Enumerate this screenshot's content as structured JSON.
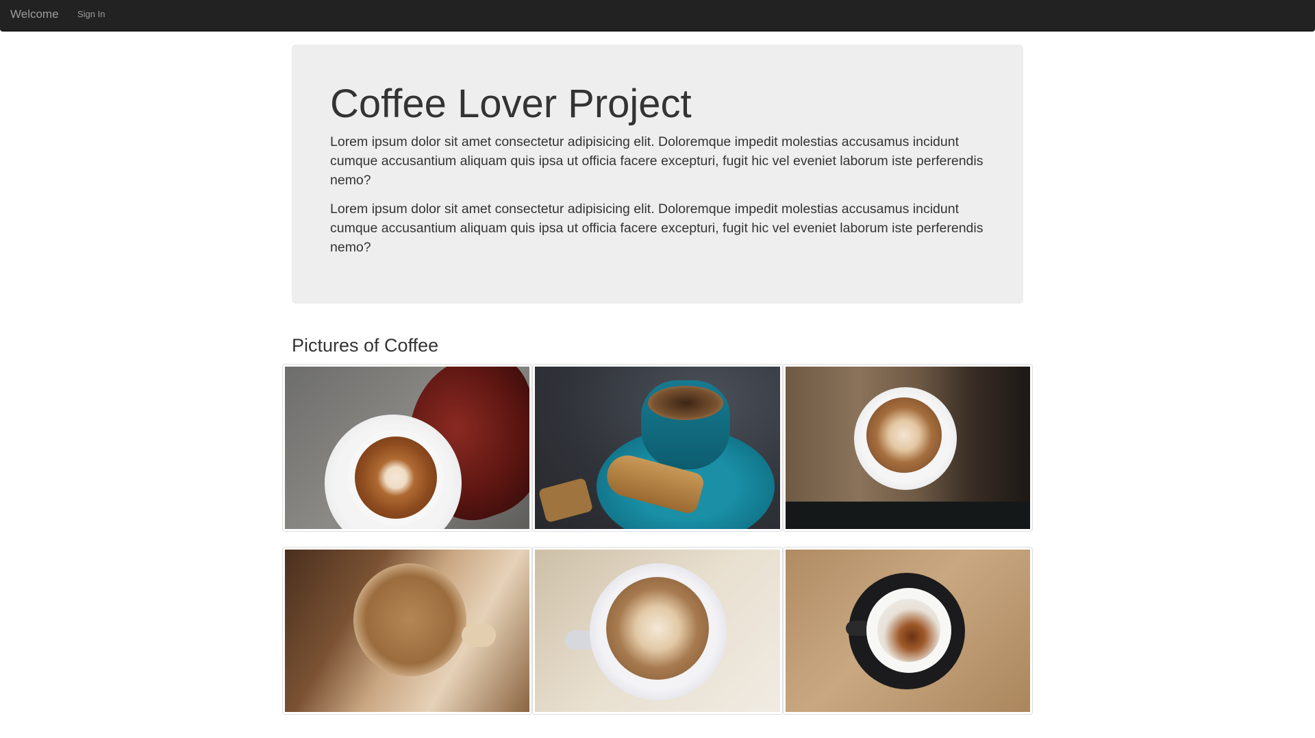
{
  "navbar": {
    "brand": "Welcome",
    "links": [
      {
        "label": "Sign In"
      }
    ]
  },
  "jumbotron": {
    "title": "Coffee Lover Project",
    "paragraphs": [
      "Lorem ipsum dolor sit amet consectetur adipisicing elit. Doloremque impedit molestias accusamus incidunt cumque accusantium aliquam quis ipsa ut officia facere excepturi, fugit hic vel eveniet laborum iste perferendis nemo?",
      "Lorem ipsum dolor sit amet consectetur adipisicing elit. Doloremque impedit molestias accusamus incidunt cumque accusantium aliquam quis ipsa ut officia facere excepturi, fugit hic vel eveniet laborum iste perferendis nemo?"
    ]
  },
  "gallery": {
    "title": "Pictures of Coffee"
  },
  "colors": {
    "navbar_bg": "#222222",
    "jumbotron_bg": "#eeeeee",
    "text": "#333333"
  }
}
